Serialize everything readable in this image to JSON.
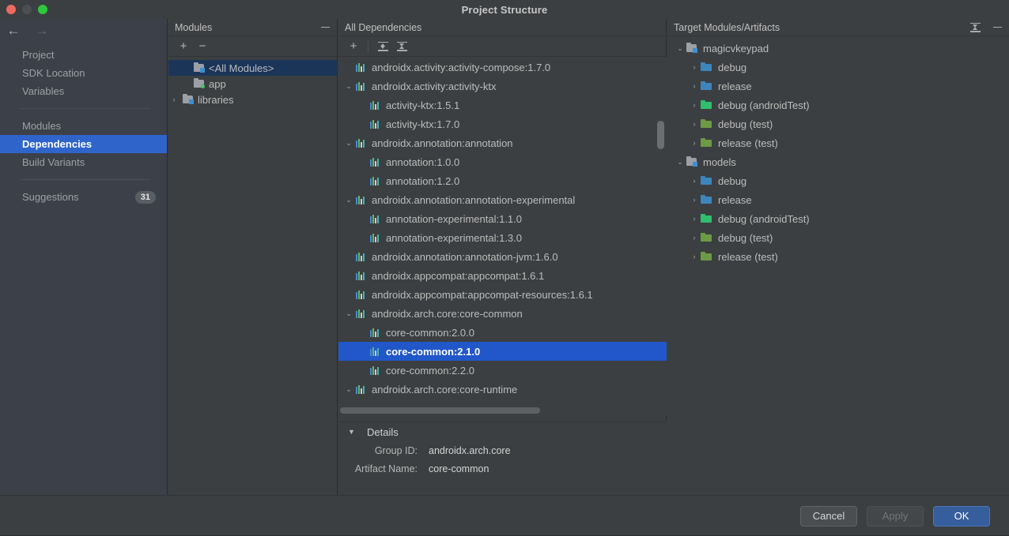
{
  "window": {
    "title": "Project Structure",
    "traffic_lights": [
      "close-red",
      "minimize-gray",
      "zoom-green"
    ]
  },
  "sidebar": {
    "nav": {
      "back": "←",
      "forward": "→"
    },
    "group_top": [
      {
        "label": "Project",
        "active": false
      },
      {
        "label": "SDK Location",
        "active": false
      },
      {
        "label": "Variables",
        "active": false
      }
    ],
    "group_mid": [
      {
        "label": "Modules",
        "active": false
      },
      {
        "label": "Dependencies",
        "active": true
      },
      {
        "label": "Build Variants",
        "active": false
      }
    ],
    "group_bottom": [
      {
        "label": "Suggestions",
        "active": false,
        "badge": "31"
      }
    ]
  },
  "modules_panel": {
    "header": "Modules",
    "toolbar": {
      "add": "+",
      "remove": "−"
    },
    "tree": [
      {
        "label": "<All Modules>",
        "indent": 1,
        "twisty": "",
        "icon": "module-all-icon",
        "selected": true
      },
      {
        "label": "app",
        "indent": 1,
        "twisty": "",
        "icon": "module-app-icon",
        "selected": false
      },
      {
        "label": "libraries",
        "indent": 0,
        "twisty": "›",
        "icon": "module-library-icon",
        "selected": false
      }
    ]
  },
  "deps_panel": {
    "header": "All Dependencies",
    "toolbar": {
      "add": "+",
      "expand_all": "expand-all-icon",
      "collapse_all": "collapse-all-icon"
    },
    "rows": [
      {
        "label": "androidx.activity:activity-compose:1.7.0",
        "level": 0,
        "twisty": "",
        "selected": false
      },
      {
        "label": "androidx.activity:activity-ktx",
        "level": 0,
        "twisty": "⌄",
        "selected": false
      },
      {
        "label": "activity-ktx:1.5.1",
        "level": 1,
        "twisty": "",
        "selected": false
      },
      {
        "label": "activity-ktx:1.7.0",
        "level": 1,
        "twisty": "",
        "selected": false
      },
      {
        "label": "androidx.annotation:annotation",
        "level": 0,
        "twisty": "⌄",
        "selected": false
      },
      {
        "label": "annotation:1.0.0",
        "level": 1,
        "twisty": "",
        "selected": false
      },
      {
        "label": "annotation:1.2.0",
        "level": 1,
        "twisty": "",
        "selected": false
      },
      {
        "label": "androidx.annotation:annotation-experimental",
        "level": 0,
        "twisty": "⌄",
        "selected": false
      },
      {
        "label": "annotation-experimental:1.1.0",
        "level": 1,
        "twisty": "",
        "selected": false
      },
      {
        "label": "annotation-experimental:1.3.0",
        "level": 1,
        "twisty": "",
        "selected": false
      },
      {
        "label": "androidx.annotation:annotation-jvm:1.6.0",
        "level": 0,
        "twisty": "",
        "selected": false
      },
      {
        "label": "androidx.appcompat:appcompat:1.6.1",
        "level": 0,
        "twisty": "",
        "selected": false
      },
      {
        "label": "androidx.appcompat:appcompat-resources:1.6.1",
        "level": 0,
        "twisty": "",
        "selected": false
      },
      {
        "label": "androidx.arch.core:core-common",
        "level": 0,
        "twisty": "⌄",
        "selected": false
      },
      {
        "label": "core-common:2.0.0",
        "level": 1,
        "twisty": "",
        "selected": false
      },
      {
        "label": "core-common:2.1.0",
        "level": 1,
        "twisty": "",
        "selected": true
      },
      {
        "label": "core-common:2.2.0",
        "level": 1,
        "twisty": "",
        "selected": false
      },
      {
        "label": "androidx.arch.core:core-runtime",
        "level": 0,
        "twisty": "⌄",
        "selected": false
      }
    ]
  },
  "details": {
    "title": "Details",
    "collapse_caret": "▼",
    "fields": [
      {
        "key": "Group ID:",
        "value": "androidx.arch.core"
      },
      {
        "key": "Artifact Name:",
        "value": "core-common"
      }
    ]
  },
  "target_panel": {
    "header": "Target Modules/Artifacts",
    "rows": [
      {
        "label": "magicvkeypad",
        "level": 0,
        "twisty": "⌄",
        "icon": "module-icon"
      },
      {
        "label": "debug",
        "level": 1,
        "twisty": "›",
        "icon": "folder-blue-icon"
      },
      {
        "label": "release",
        "level": 1,
        "twisty": "›",
        "icon": "folder-blue-icon"
      },
      {
        "label": "debug (androidTest)",
        "level": 1,
        "twisty": "›",
        "icon": "folder-green-icon"
      },
      {
        "label": "debug (test)",
        "level": 1,
        "twisty": "›",
        "icon": "folder-olive-icon"
      },
      {
        "label": "release (test)",
        "level": 1,
        "twisty": "›",
        "icon": "folder-olive-icon"
      },
      {
        "label": "models",
        "level": 0,
        "twisty": "⌄",
        "icon": "module-icon"
      },
      {
        "label": "debug",
        "level": 1,
        "twisty": "›",
        "icon": "folder-blue-icon"
      },
      {
        "label": "release",
        "level": 1,
        "twisty": "›",
        "icon": "folder-blue-icon"
      },
      {
        "label": "debug (androidTest)",
        "level": 1,
        "twisty": "›",
        "icon": "folder-green-icon"
      },
      {
        "label": "debug (test)",
        "level": 1,
        "twisty": "›",
        "icon": "folder-olive-icon"
      },
      {
        "label": "release (test)",
        "level": 1,
        "twisty": "›",
        "icon": "folder-olive-icon"
      }
    ]
  },
  "footer": {
    "cancel": "Cancel",
    "apply": "Apply",
    "ok": "OK"
  },
  "colors": {
    "accent_selection": "#2157c9",
    "sidebar_selection": "#2f65cb",
    "primary_button": "#375e9c",
    "window_bg": "#3c3f41",
    "sidebar_bg": "#3c4048"
  }
}
